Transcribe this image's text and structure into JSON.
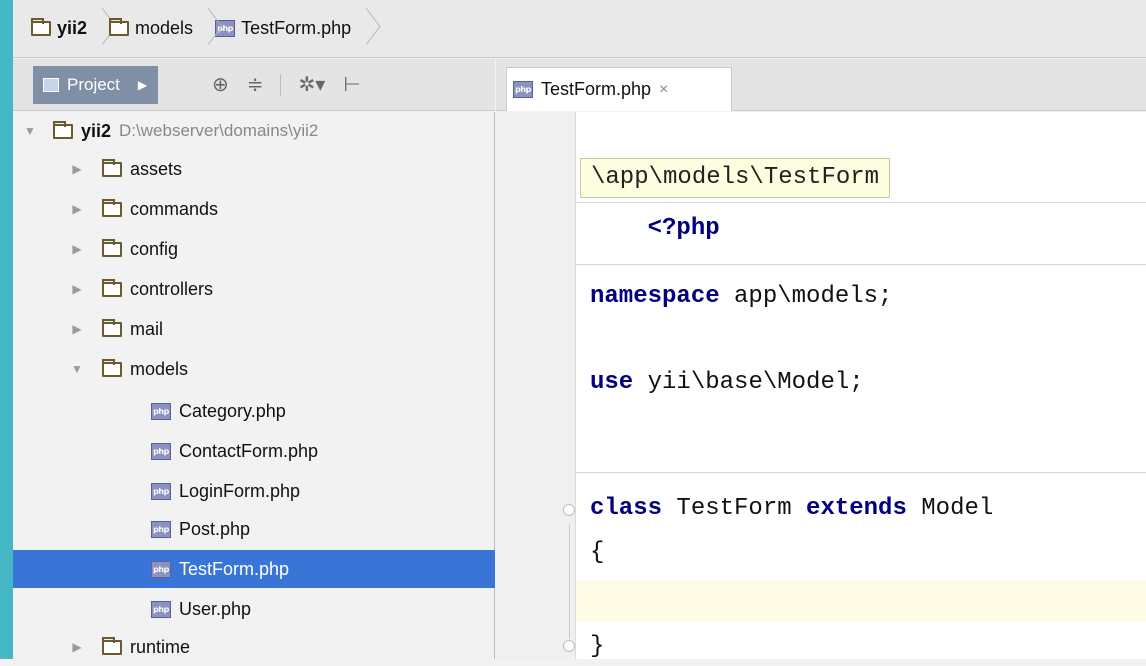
{
  "breadcrumb": {
    "items": [
      {
        "label": "yii2",
        "icon": "folder-icon",
        "bold": true
      },
      {
        "label": "models",
        "icon": "folder-icon",
        "bold": false
      },
      {
        "label": "TestForm.php",
        "icon": "php-file-icon",
        "bold": false
      }
    ]
  },
  "project_panel": {
    "tab_label": "Project",
    "root": {
      "label": "yii2",
      "path": "D:\\webserver\\domains\\yii2"
    },
    "folders": [
      "assets",
      "commands",
      "config",
      "controllers",
      "mail",
      "models"
    ],
    "model_files": [
      "Category.php",
      "ContactForm.php",
      "LoginForm.php",
      "Post.php",
      "TestForm.php",
      "User.php"
    ],
    "after_folders": [
      "runtime"
    ],
    "selected_file": "TestForm.php"
  },
  "editor": {
    "tab_label": "TestForm.php",
    "tab_close": "×",
    "namespace_hint": "\\app\\models\\TestForm",
    "code": {
      "open_tag": "<?php",
      "namespace_kw": "namespace",
      "namespace_val": " app\\models;",
      "use_kw": "use",
      "use_val": " yii\\base\\Model;",
      "class_kw": "class",
      "class_name": " TestForm ",
      "extends_kw": "extends",
      "parent": " Model",
      "open_brace": "{",
      "close_brace": "}"
    }
  },
  "colors": {
    "accent_stripe": "#46b7c4",
    "selection": "#3875d7",
    "keyword": "#000080"
  }
}
